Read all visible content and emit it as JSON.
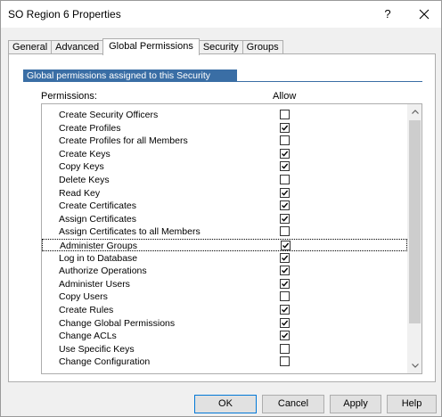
{
  "window": {
    "title": "SO Region 6 Properties",
    "help_label": "?",
    "close_label": "✕"
  },
  "tabs": [
    {
      "label": "General",
      "active": false
    },
    {
      "label": "Advanced",
      "active": false
    },
    {
      "label": "Global Permissions",
      "active": true
    },
    {
      "label": "Security",
      "active": false
    },
    {
      "label": "Groups",
      "active": false
    }
  ],
  "panel": {
    "group_label": "Global permissions assigned to this Security Officer",
    "permissions_header": "Permissions:",
    "allow_header": "Allow"
  },
  "permissions": [
    {
      "name": "Create Security Officers",
      "allow": false
    },
    {
      "name": "Create Profiles",
      "allow": true
    },
    {
      "name": "Create Profiles for all Members",
      "allow": false
    },
    {
      "name": "Create Keys",
      "allow": true
    },
    {
      "name": "Copy Keys",
      "allow": true
    },
    {
      "name": "Delete Keys",
      "allow": false
    },
    {
      "name": "Read Key",
      "allow": true
    },
    {
      "name": "Create Certificates",
      "allow": true
    },
    {
      "name": "Assign Certificates",
      "allow": true
    },
    {
      "name": "Assign Certificates to all Members",
      "allow": false
    },
    {
      "name": "Administer Groups",
      "allow": true,
      "focused": true
    },
    {
      "name": "Log in to Database",
      "allow": true
    },
    {
      "name": "Authorize Operations",
      "allow": true
    },
    {
      "name": "Administer Users",
      "allow": true
    },
    {
      "name": "Copy Users",
      "allow": false
    },
    {
      "name": "Create Rules",
      "allow": true
    },
    {
      "name": "Change Global Permissions",
      "allow": true
    },
    {
      "name": "Change ACLs",
      "allow": true
    },
    {
      "name": "Use Specific Keys",
      "allow": false
    },
    {
      "name": "Change Configuration",
      "allow": false
    }
  ],
  "scrollbar": {
    "up_icon": "chevron-up-icon",
    "down_icon": "chevron-down-icon"
  },
  "buttons": {
    "ok": "OK",
    "cancel": "Cancel",
    "apply": "Apply",
    "help": "Help"
  }
}
